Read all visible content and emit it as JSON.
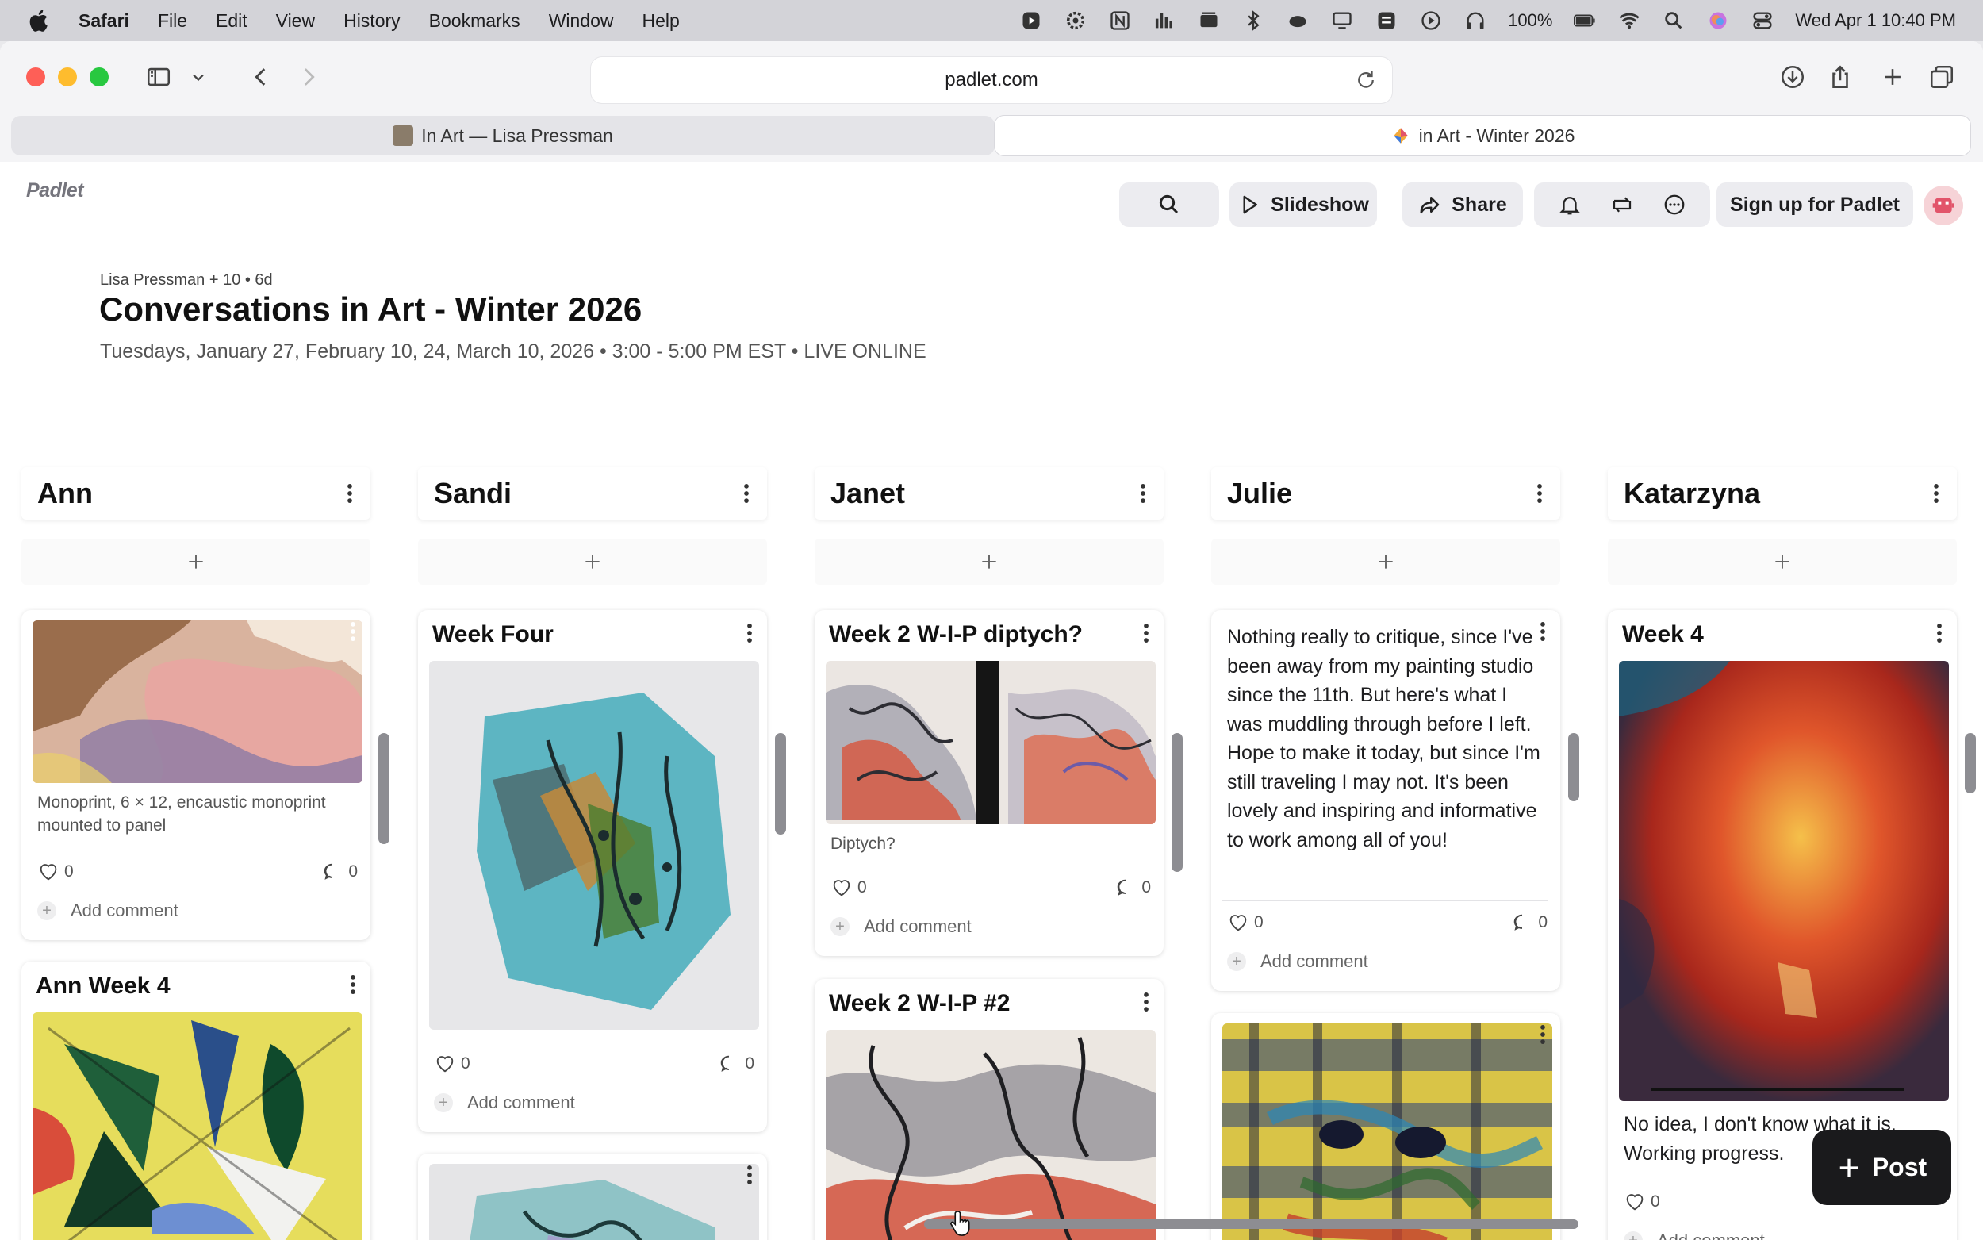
{
  "menubar": {
    "app_name": "Safari",
    "items": [
      "File",
      "Edit",
      "View",
      "History",
      "Bookmarks",
      "Window",
      "Help"
    ],
    "battery": "100%",
    "datetime": "Wed Apr 1  10:40 PM"
  },
  "browser": {
    "url": "padlet.com",
    "tabs": [
      {
        "label": "In Art — Lisa Pressman"
      },
      {
        "label": "in Art - Winter 2026"
      }
    ]
  },
  "padlet": {
    "logo": "Padlet",
    "header": {
      "slideshow": "Slideshow",
      "share": "Share",
      "signup": "Sign up for Padlet"
    },
    "byline": "Lisa Pressman + 10 • 6d",
    "title": "Conversations in Art - Winter 2026",
    "subtitle": "Tuesdays, January 27, February 10, 24, March 10, 2026 • 3:00 - 5:00 PM EST • LIVE ONLINE",
    "columns": [
      {
        "name": "Ann",
        "cards": [
          {
            "title": "",
            "caption": "Monoprint, 6 × 12, encaustic monoprint mounted to panel",
            "likes": "0",
            "comments": "0",
            "add_comment": "Add comment"
          },
          {
            "title": "Ann Week 4"
          }
        ]
      },
      {
        "name": "Sandi",
        "cards": [
          {
            "title": "Week Four",
            "likes": "0",
            "comments": "0",
            "add_comment": "Add comment"
          },
          {
            "title": ""
          }
        ]
      },
      {
        "name": "Janet",
        "cards": [
          {
            "title": "Week 2 W-I-P diptych?",
            "caption": "Diptych?",
            "likes": "0",
            "comments": "0",
            "add_comment": "Add comment"
          },
          {
            "title": "Week 2 W-I-P #2"
          }
        ]
      },
      {
        "name": "Julie",
        "cards": [
          {
            "body": "Nothing really to critique, since I've been away from my painting studio since the 11th. But here's what I was muddling through before I left. Hope to make it today, but since I'm still traveling I may not. It's been lovely and inspiring and informative to work among all of you!",
            "likes": "0",
            "comments": "0",
            "add_comment": "Add comment"
          },
          {
            "title": ""
          }
        ]
      },
      {
        "name": "Katarzyna",
        "cards": [
          {
            "title": "Week 4",
            "body": "No idea, I don't know what it is. Working progress.",
            "likes": "0",
            "add_comment": "Add comment"
          }
        ]
      }
    ],
    "post_button": "Post"
  }
}
